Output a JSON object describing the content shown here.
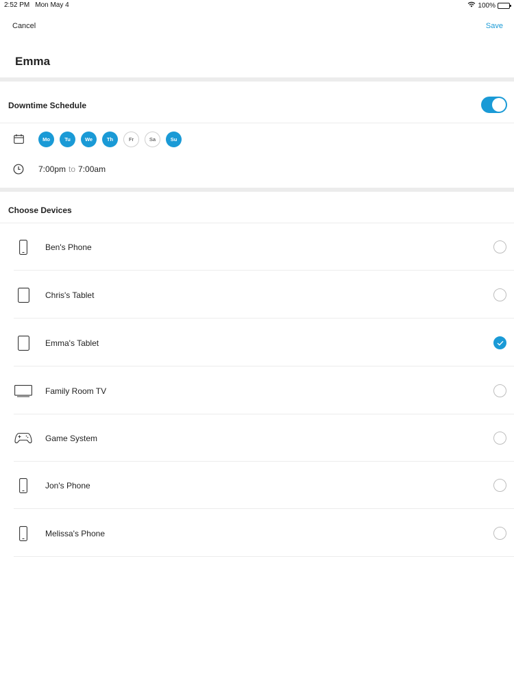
{
  "status_bar": {
    "time": "2:52 PM",
    "date": "Mon May 4",
    "battery": "100%"
  },
  "nav": {
    "cancel": "Cancel",
    "save": "Save"
  },
  "profile": {
    "name": "Emma"
  },
  "schedule": {
    "title": "Downtime Schedule",
    "enabled": true,
    "days": [
      {
        "label": "Mo",
        "active": true
      },
      {
        "label": "Tu",
        "active": true
      },
      {
        "label": "We",
        "active": true
      },
      {
        "label": "Th",
        "active": true
      },
      {
        "label": "Fr",
        "active": false
      },
      {
        "label": "Sa",
        "active": false
      },
      {
        "label": "Su",
        "active": true
      }
    ],
    "time_start": "7:00pm",
    "time_to": "to",
    "time_end": "7:00am"
  },
  "devices": {
    "title": "Choose Devices",
    "items": [
      {
        "label": "Ben's Phone",
        "icon": "phone-icon",
        "selected": false
      },
      {
        "label": "Chris's Tablet",
        "icon": "tablet-icon",
        "selected": false
      },
      {
        "label": "Emma's Tablet",
        "icon": "tablet-icon",
        "selected": true
      },
      {
        "label": "Family Room TV",
        "icon": "tv-icon",
        "selected": false
      },
      {
        "label": "Game System",
        "icon": "gamepad-icon",
        "selected": false
      },
      {
        "label": "Jon's Phone",
        "icon": "phone-icon",
        "selected": false
      },
      {
        "label": "Melissa's Phone",
        "icon": "phone-icon",
        "selected": false
      }
    ]
  },
  "colors": {
    "accent": "#1a9ad6",
    "divider": "#ececec"
  }
}
